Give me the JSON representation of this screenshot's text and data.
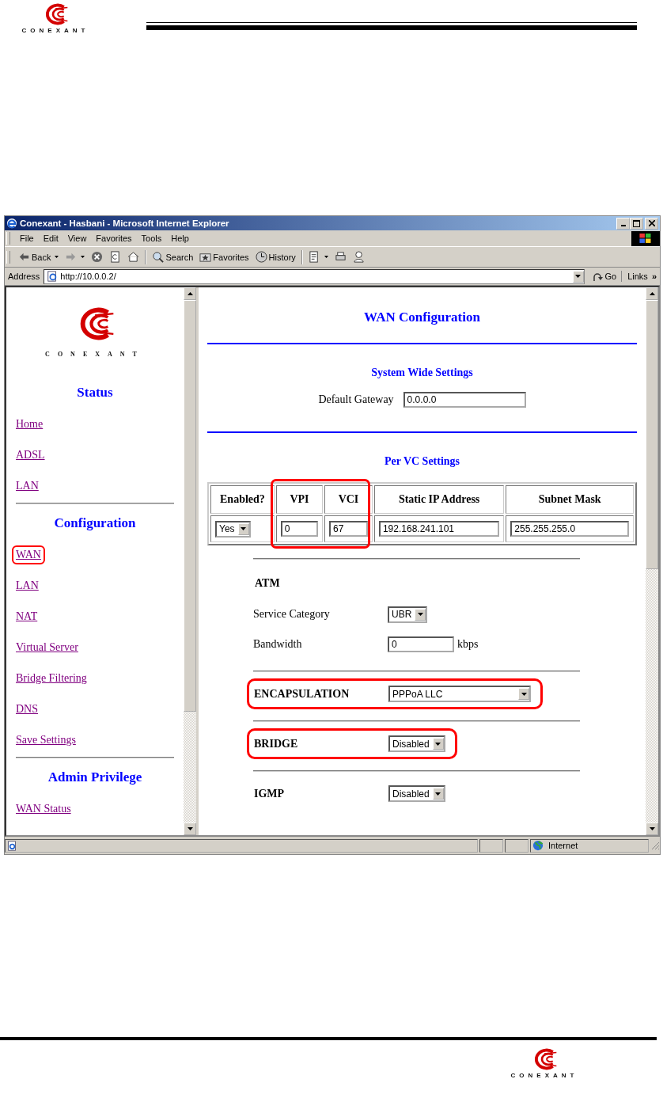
{
  "document": {
    "header_logo": "CONEXANT",
    "footer_logo": "CONEXANT"
  },
  "window": {
    "title": "Conexant - Hasbani - Microsoft Internet Explorer"
  },
  "menu": [
    "File",
    "Edit",
    "View",
    "Favorites",
    "Tools",
    "Help"
  ],
  "toolbar": [
    {
      "buttons": [
        {
          "kind": "back",
          "label": "Back",
          "dropdown": true
        },
        {
          "kind": "forward",
          "dropdown": true
        },
        {
          "kind": "stop"
        },
        {
          "kind": "refresh"
        },
        {
          "kind": "home"
        }
      ]
    },
    {
      "buttons": [
        {
          "kind": "search",
          "label": "Search"
        },
        {
          "kind": "favorites",
          "label": "Favorites"
        },
        {
          "kind": "history",
          "label": "History"
        }
      ]
    },
    {
      "buttons": [
        {
          "kind": "edit",
          "dropdown": true
        },
        {
          "kind": "print"
        },
        {
          "kind": "messenger"
        }
      ]
    }
  ],
  "address_bar": {
    "label": "Address",
    "url": "http://10.0.0.2/",
    "go": "Go",
    "links": "Links",
    "more": "»"
  },
  "sidebar": {
    "logo": "CONEXANT",
    "sections": [
      {
        "heading": "Status",
        "links": [
          {
            "label": "Home",
            "highlighted": false
          },
          {
            "label": "ADSL",
            "highlighted": false
          },
          {
            "label": "LAN",
            "highlighted": false
          }
        ]
      },
      {
        "heading": "Configuration",
        "links": [
          {
            "label": "WAN",
            "highlighted": true
          },
          {
            "label": "LAN",
            "highlighted": false
          },
          {
            "label": "NAT",
            "highlighted": false
          },
          {
            "label": "Virtual Server",
            "highlighted": false
          },
          {
            "label": "Bridge Filtering",
            "highlighted": false
          },
          {
            "label": "DNS",
            "highlighted": false
          },
          {
            "label": "Save Settings",
            "highlighted": false
          }
        ]
      },
      {
        "heading": "Admin Privilege",
        "links": [
          {
            "label": "WAN Status",
            "highlighted": false
          }
        ]
      }
    ]
  },
  "content": {
    "title": "WAN Configuration",
    "system_heading": "System Wide Settings",
    "gateway": {
      "label": "Default Gateway",
      "value": "0.0.0.0"
    },
    "vc_heading": "Per VC Settings",
    "vc_table": {
      "columns": [
        {
          "label": "Enabled?",
          "highlighted": false
        },
        {
          "label": "VPI",
          "highlighted": true
        },
        {
          "label": "VCI",
          "highlighted": true
        },
        {
          "label": "Static IP Address",
          "highlighted": false
        },
        {
          "label": "Subnet Mask",
          "highlighted": false
        }
      ],
      "row": [
        {
          "kind": "select",
          "value": "Yes"
        },
        {
          "kind": "input",
          "value": "0"
        },
        {
          "kind": "input",
          "value": "67"
        },
        {
          "kind": "input",
          "value": "192.168.241.101"
        },
        {
          "kind": "input",
          "value": "255.255.255.0"
        }
      ]
    },
    "groups": [
      {
        "heading": "ATM",
        "highlighted": false,
        "rows": [
          {
            "label": "Service Category",
            "kind": "select",
            "value": "UBR"
          },
          {
            "label": "Bandwidth",
            "kind": "input",
            "value": "0",
            "unit": "kbps"
          }
        ]
      },
      {
        "heading": "ENCAPSULATION",
        "highlighted": true,
        "control": {
          "kind": "select",
          "value": "PPPoA LLC",
          "wide": true
        }
      },
      {
        "heading": "BRIDGE",
        "highlighted": true,
        "control": {
          "kind": "select",
          "value": "Disabled",
          "wide": false
        }
      },
      {
        "heading": "IGMP",
        "highlighted": false,
        "control": {
          "kind": "select",
          "value": "Disabled",
          "wide": false
        }
      }
    ]
  },
  "status_bar": {
    "zone": "Internet"
  }
}
